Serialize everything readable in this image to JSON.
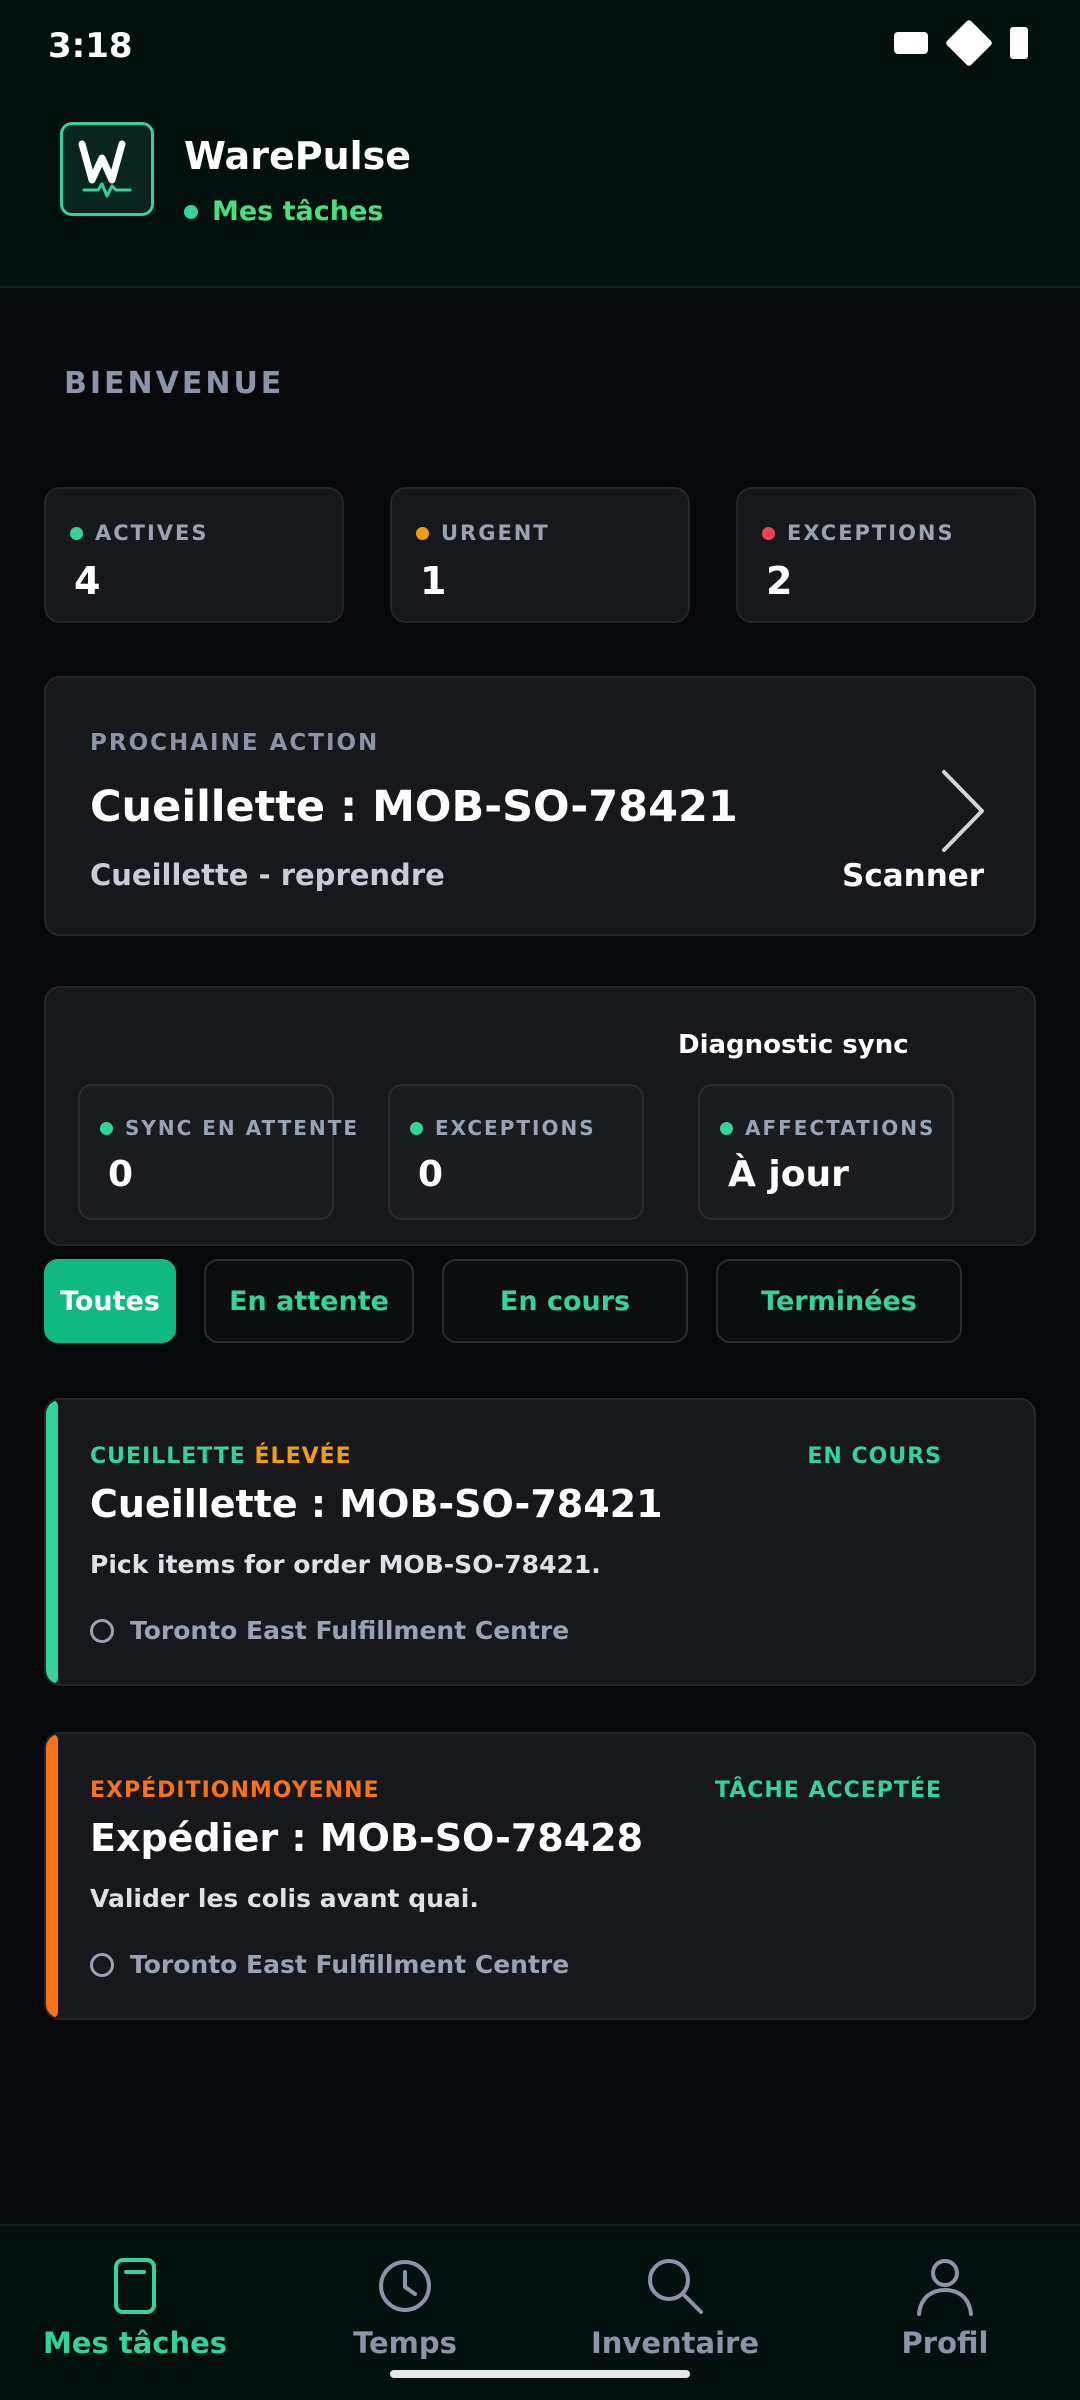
{
  "status": {
    "time": "3:18"
  },
  "app": {
    "title": "WarePulse",
    "subtitle": "Mes tâches",
    "logo_letter": "W"
  },
  "welcome": "BIENVENUE",
  "stats": [
    {
      "label": "ACTIVES",
      "value": "4",
      "color": "#34d399"
    },
    {
      "label": "URGENT",
      "value": "1",
      "color": "#f59e0b"
    },
    {
      "label": "EXCEPTIONS",
      "value": "2",
      "color": "#f43f5e"
    }
  ],
  "next_action": {
    "kicker": "PROCHAINE ACTION",
    "title": "Cueillette : MOB-SO-78421",
    "subtitle": "Cueillette - reprendre",
    "cta": "Scanner"
  },
  "diagnostic": {
    "heading": "Diagnostic sync",
    "items": [
      {
        "label": "SYNC EN ATTENTE",
        "value": "0"
      },
      {
        "label": "EXCEPTIONS",
        "value": "0"
      },
      {
        "label": "AFFECTATIONS",
        "value": "À jour"
      }
    ]
  },
  "filters": [
    "Toutes",
    "En attente",
    "En cours",
    "Terminées"
  ],
  "tasks": [
    {
      "category": "CUEILLETTE",
      "priority": "ÉLEVÉE",
      "status": "EN COURS",
      "title": "Cueillette : MOB-SO-78421",
      "description": "Pick items for order MOB-SO-78421.",
      "location": "Toronto East Fulfillment Centre",
      "accent": "#34d399",
      "category_color": "#34d399",
      "priority_color": "#f59e0b"
    },
    {
      "category": "EXPÉDITION",
      "priority": "MOYENNE",
      "status": "TÂCHE ACCEPTÉE",
      "title": "Expédier : MOB-SO-78428",
      "description": "Valider les colis avant quai.",
      "location": "Toronto East Fulfillment Centre",
      "accent": "#f97316",
      "category_color": "#f97316",
      "priority_color": "#f97316"
    }
  ],
  "nav": [
    {
      "label": "Mes tâches",
      "icon": "tasks-icon"
    },
    {
      "label": "Temps",
      "icon": "clock-icon"
    },
    {
      "label": "Inventaire",
      "icon": "search-icon"
    },
    {
      "label": "Profil",
      "icon": "user-icon"
    }
  ],
  "colors": {
    "accent": "#10b981",
    "background": "#070809",
    "card": "#17181b"
  }
}
